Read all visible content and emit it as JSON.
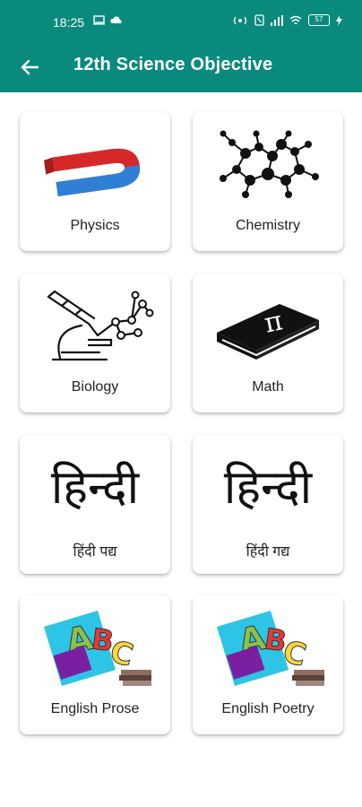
{
  "status_bar": {
    "time": "18:25",
    "battery": "57"
  },
  "toolbar": {
    "title": "12th Science Objective"
  },
  "subjects": [
    {
      "label": "Physics",
      "icon": "magnet-icon"
    },
    {
      "label": "Chemistry",
      "icon": "molecule-icon"
    },
    {
      "label": "Biology",
      "icon": "microscope-icon"
    },
    {
      "label": "Math",
      "icon": "pi-book-icon"
    },
    {
      "label": "हिंदी पद्य",
      "icon": "hindi-text-icon",
      "art_text": "हिन्दी"
    },
    {
      "label": "हिंदी गद्य",
      "icon": "hindi-text-icon",
      "art_text": "हिन्दी"
    },
    {
      "label": "English Prose",
      "icon": "abc-books-icon"
    },
    {
      "label": "English Poetry",
      "icon": "abc-books-icon"
    }
  ],
  "colors": {
    "app_bar": "#0a8a7c",
    "card_bg": "#ffffff",
    "magnet_red": "#d62828",
    "magnet_blue": "#2f7fd6"
  }
}
